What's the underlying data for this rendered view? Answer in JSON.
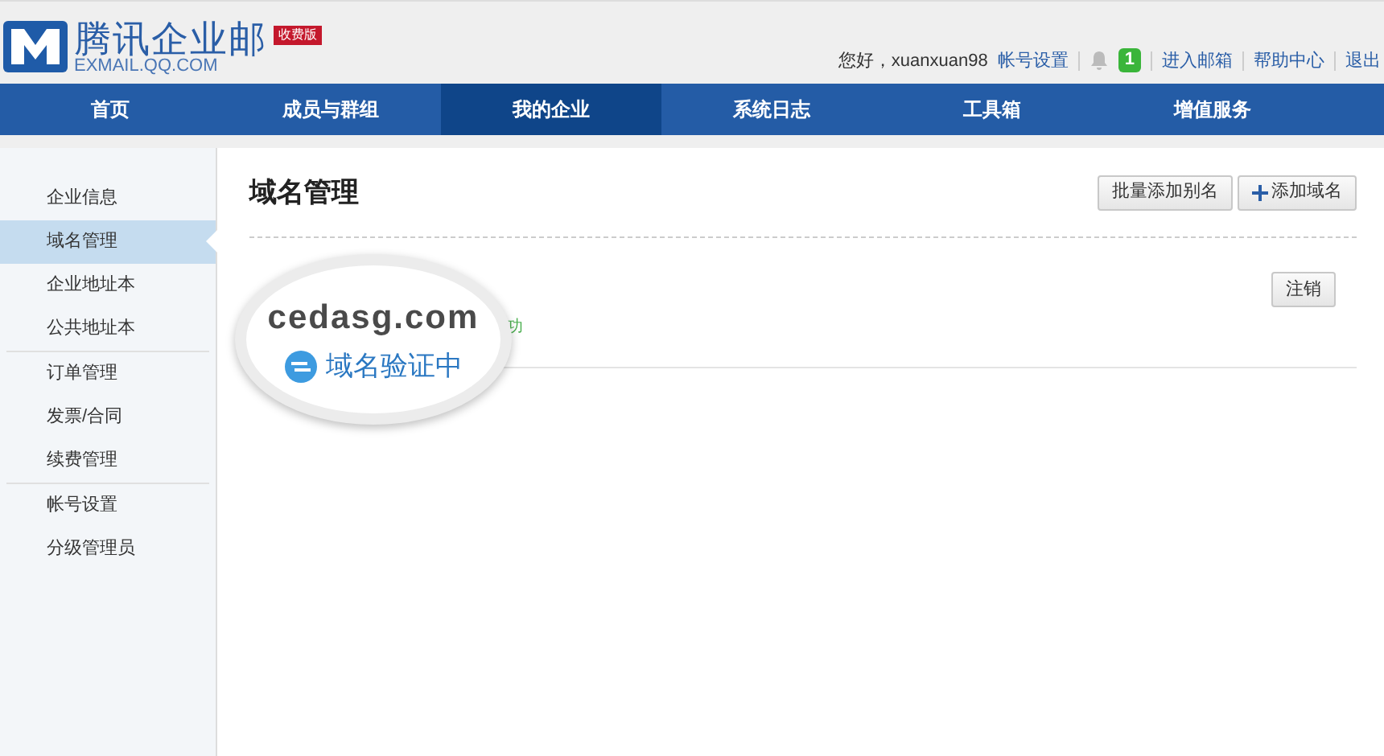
{
  "header": {
    "logo_title": "腾讯企业邮",
    "logo_subtitle": "EXMAIL.QQ.COM",
    "edition_badge": "收费版",
    "greeting": "您好，xuanxuan98",
    "account_link": "帐号设置",
    "notification_count": "1",
    "links": [
      "进入邮箱",
      "帮助中心",
      "退出"
    ]
  },
  "nav": [
    {
      "label": "首页",
      "selected": false
    },
    {
      "label": "成员与群组",
      "selected": false
    },
    {
      "label": "我的企业",
      "selected": true
    },
    {
      "label": "系统日志",
      "selected": false
    },
    {
      "label": "工具箱",
      "selected": false
    },
    {
      "label": "增值服务",
      "selected": false
    }
  ],
  "sidebar": [
    [
      {
        "label": "企业信息",
        "selected": false
      },
      {
        "label": "域名管理",
        "selected": true
      },
      {
        "label": "企业地址本",
        "selected": false
      },
      {
        "label": "公共地址本",
        "selected": false
      }
    ],
    [
      {
        "label": "订单管理",
        "selected": false
      },
      {
        "label": "发票/合同",
        "selected": false
      },
      {
        "label": "续费管理",
        "selected": false
      }
    ],
    [
      {
        "label": "帐号设置",
        "selected": false
      },
      {
        "label": "分级管理员",
        "selected": false
      }
    ]
  ],
  "main": {
    "title": "域名管理",
    "buttons": [
      {
        "label": "批量添加别名",
        "kind": "plain"
      },
      {
        "label": "添加域名",
        "kind": "add"
      }
    ],
    "domain_row": {
      "status": "功",
      "action": "注销"
    },
    "magnifier": {
      "domain": "cedasg.com",
      "verification": "域名验证中"
    }
  }
}
